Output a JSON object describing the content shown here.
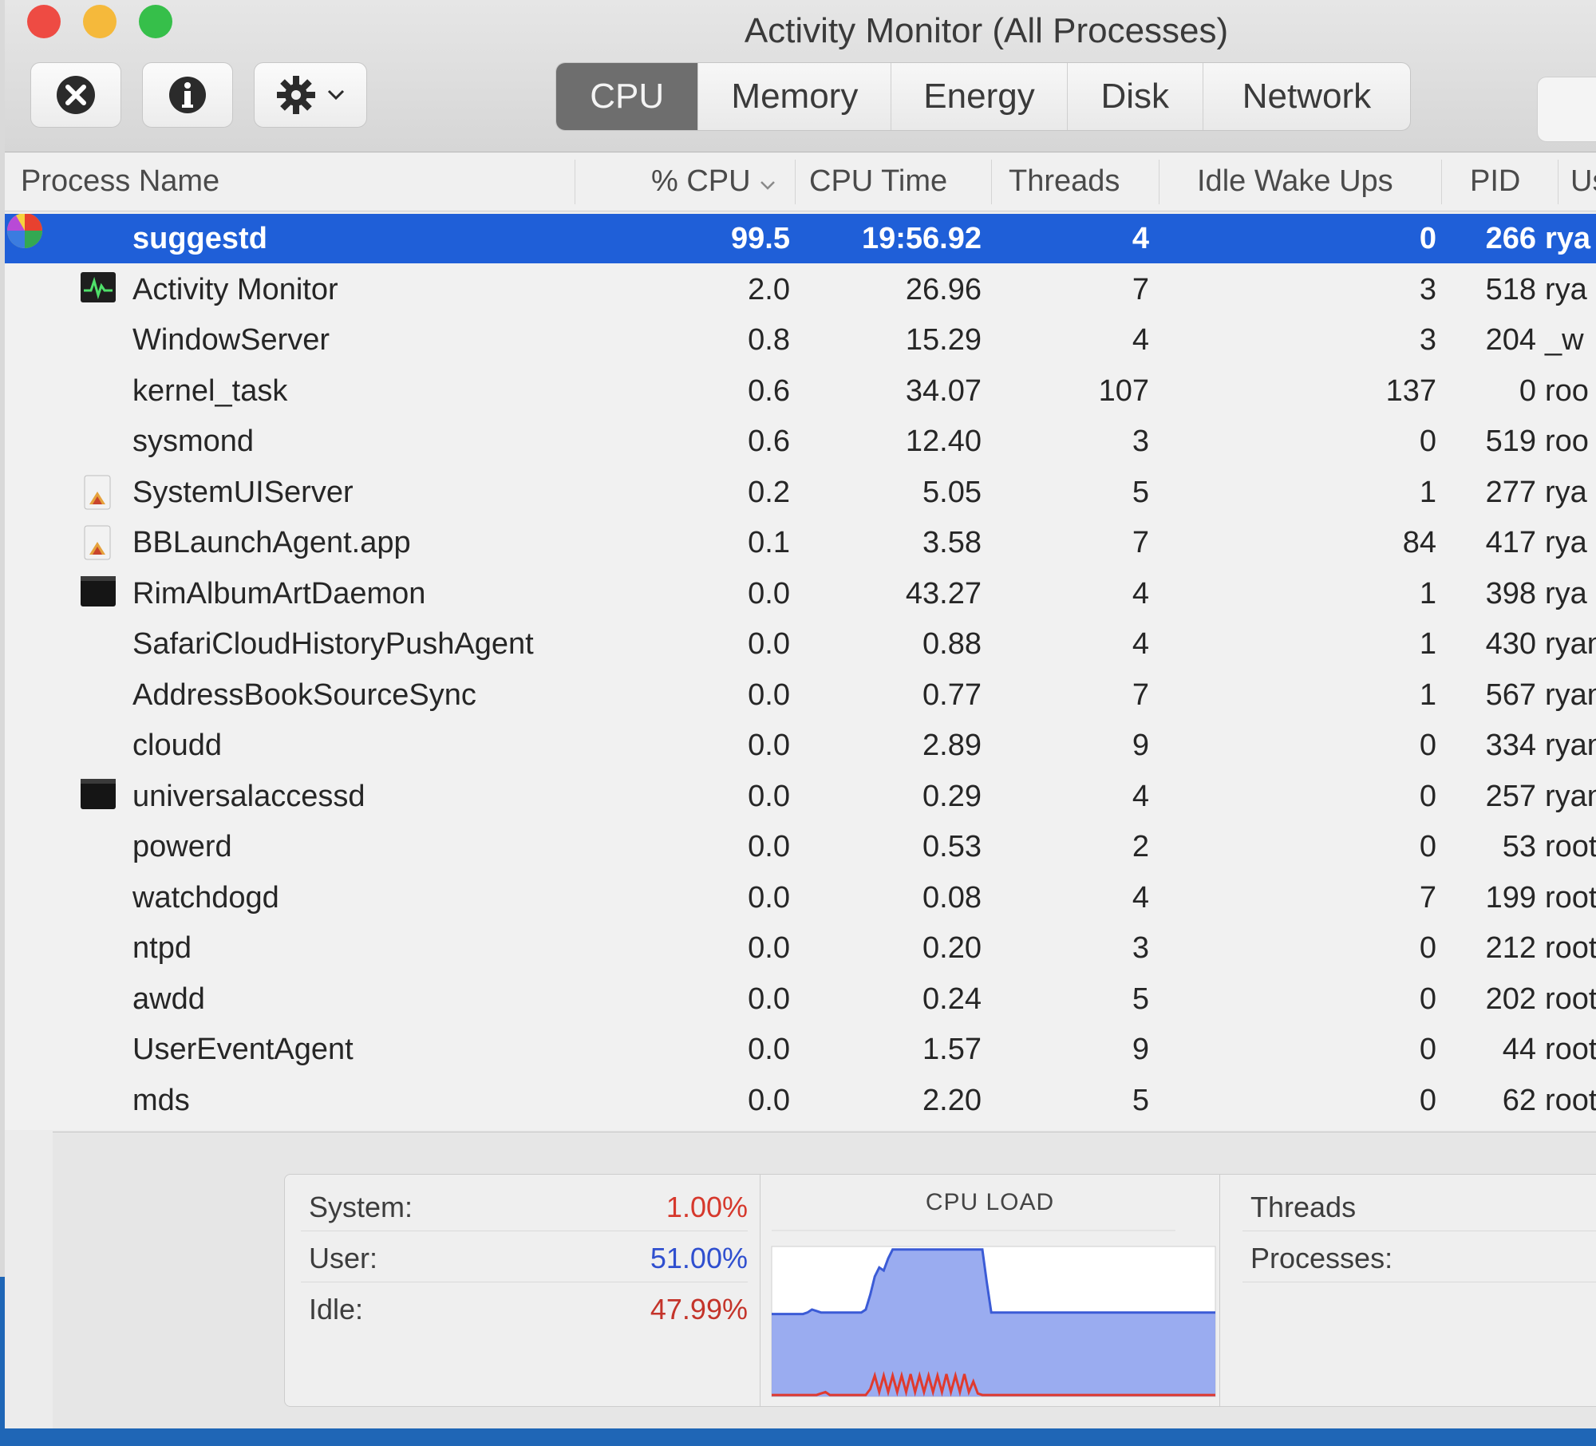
{
  "window": {
    "title": "Activity Monitor (All Processes)"
  },
  "tabs": [
    {
      "label": "CPU",
      "active": true
    },
    {
      "label": "Memory",
      "active": false
    },
    {
      "label": "Energy",
      "active": false
    },
    {
      "label": "Disk",
      "active": false
    },
    {
      "label": "Network",
      "active": false
    }
  ],
  "columns": {
    "name": "Process Name",
    "cpu": "% CPU",
    "time": "CPU Time",
    "threads": "Threads",
    "idle": "Idle Wake Ups",
    "pid": "PID",
    "user": "Us"
  },
  "processes": [
    {
      "name": "suggestd",
      "cpu": "99.5",
      "time": "19:56.92",
      "threads": "4",
      "idle": "0",
      "pid": "266",
      "user": "rya",
      "icon": "colorful-pinwheel-icon"
    },
    {
      "name": "Activity Monitor",
      "cpu": "2.0",
      "time": "26.96",
      "threads": "7",
      "idle": "3",
      "pid": "518",
      "user": "rya",
      "icon": "activity-monitor-icon"
    },
    {
      "name": "WindowServer",
      "cpu": "0.8",
      "time": "15.29",
      "threads": "4",
      "idle": "3",
      "pid": "204",
      "user": "_w",
      "icon": ""
    },
    {
      "name": "kernel_task",
      "cpu": "0.6",
      "time": "34.07",
      "threads": "107",
      "idle": "137",
      "pid": "0",
      "user": "roo",
      "icon": ""
    },
    {
      "name": "sysmond",
      "cpu": "0.6",
      "time": "12.40",
      "threads": "3",
      "idle": "0",
      "pid": "519",
      "user": "roo",
      "icon": ""
    },
    {
      "name": "SystemUIServer",
      "cpu": "0.2",
      "time": "5.05",
      "threads": "5",
      "idle": "1",
      "pid": "277",
      "user": "rya",
      "icon": "app-document-icon"
    },
    {
      "name": "BBLaunchAgent.app",
      "cpu": "0.1",
      "time": "3.58",
      "threads": "7",
      "idle": "84",
      "pid": "417",
      "user": "rya",
      "icon": "app-document-icon"
    },
    {
      "name": "RimAlbumArtDaemon",
      "cpu": "0.0",
      "time": "43.27",
      "threads": "4",
      "idle": "1",
      "pid": "398",
      "user": "rya",
      "icon": "terminal-icon"
    },
    {
      "name": "SafariCloudHistoryPushAgent",
      "cpu": "0.0",
      "time": "0.88",
      "threads": "4",
      "idle": "1",
      "pid": "430",
      "user": "ryan",
      "icon": ""
    },
    {
      "name": "AddressBookSourceSync",
      "cpu": "0.0",
      "time": "0.77",
      "threads": "7",
      "idle": "1",
      "pid": "567",
      "user": "ryan",
      "icon": ""
    },
    {
      "name": "cloudd",
      "cpu": "0.0",
      "time": "2.89",
      "threads": "9",
      "idle": "0",
      "pid": "334",
      "user": "ryan",
      "icon": ""
    },
    {
      "name": "universalaccessd",
      "cpu": "0.0",
      "time": "0.29",
      "threads": "4",
      "idle": "0",
      "pid": "257",
      "user": "ryan",
      "icon": "terminal-icon"
    },
    {
      "name": "powerd",
      "cpu": "0.0",
      "time": "0.53",
      "threads": "2",
      "idle": "0",
      "pid": "53",
      "user": "root",
      "icon": ""
    },
    {
      "name": "watchdogd",
      "cpu": "0.0",
      "time": "0.08",
      "threads": "4",
      "idle": "7",
      "pid": "199",
      "user": "root",
      "icon": ""
    },
    {
      "name": "ntpd",
      "cpu": "0.0",
      "time": "0.20",
      "threads": "3",
      "idle": "0",
      "pid": "212",
      "user": "root",
      "icon": ""
    },
    {
      "name": "awdd",
      "cpu": "0.0",
      "time": "0.24",
      "threads": "5",
      "idle": "0",
      "pid": "202",
      "user": "root",
      "icon": ""
    },
    {
      "name": "UserEventAgent",
      "cpu": "0.0",
      "time": "1.57",
      "threads": "9",
      "idle": "0",
      "pid": "44",
      "user": "root",
      "icon": ""
    },
    {
      "name": "mds",
      "cpu": "0.0",
      "time": "2.20",
      "threads": "5",
      "idle": "0",
      "pid": "62",
      "user": "root",
      "icon": ""
    }
  ],
  "stats": {
    "system_label": "System:",
    "system_value": "1.00%",
    "user_label": "User:",
    "user_value": "51.00%",
    "idle_label": "Idle:",
    "idle_value": "47.99%",
    "threads_label": "Threads",
    "processes_label": "Processes:"
  },
  "chart": {
    "title": "CPU LOAD",
    "user_color": "#3b5bd6",
    "system_color": "#e03a2e",
    "user_load": [
      0.55,
      0.55,
      0.55,
      0.55,
      0.55,
      0.55,
      0.55,
      0.55,
      0.56,
      0.58,
      0.57,
      0.56,
      0.56,
      0.56,
      0.56,
      0.56,
      0.56,
      0.56,
      0.56,
      0.56,
      0.56,
      0.58,
      0.68,
      0.8,
      0.86,
      0.84,
      0.92,
      0.98,
      0.98,
      0.98,
      0.98,
      0.98,
      0.98,
      0.98,
      0.98,
      0.98,
      0.98,
      0.98,
      0.98,
      0.98,
      0.98,
      0.98,
      0.98,
      0.98,
      0.98,
      0.98,
      0.98,
      0.98,
      0.76,
      0.56,
      0.56,
      0.56,
      0.56,
      0.56,
      0.56,
      0.56,
      0.56,
      0.56,
      0.56,
      0.56,
      0.56,
      0.56,
      0.56,
      0.56,
      0.56,
      0.56,
      0.56,
      0.56,
      0.56,
      0.56,
      0.56,
      0.56,
      0.56,
      0.56,
      0.56,
      0.56,
      0.56,
      0.56,
      0.56,
      0.56,
      0.56,
      0.56,
      0.56,
      0.56,
      0.56,
      0.56,
      0.56,
      0.56,
      0.56,
      0.56,
      0.56,
      0.56,
      0.56,
      0.56,
      0.56,
      0.56,
      0.56,
      0.56,
      0.56,
      0.56
    ],
    "system_load": [
      0.01,
      0.01,
      0.01,
      0.01,
      0.01,
      0.01,
      0.01,
      0.01,
      0.01,
      0.01,
      0.01,
      0.02,
      0.03,
      0.01,
      0.01,
      0.01,
      0.01,
      0.01,
      0.01,
      0.01,
      0.01,
      0.01,
      0.05,
      0.14,
      0.03,
      0.14,
      0.03,
      0.14,
      0.03,
      0.14,
      0.03,
      0.15,
      0.03,
      0.14,
      0.03,
      0.14,
      0.03,
      0.14,
      0.03,
      0.15,
      0.03,
      0.14,
      0.03,
      0.15,
      0.03,
      0.1,
      0.02,
      0.01,
      0.01,
      0.01,
      0.01,
      0.01,
      0.01,
      0.01,
      0.01,
      0.01,
      0.01,
      0.01,
      0.01,
      0.01,
      0.01,
      0.01,
      0.01,
      0.01,
      0.01,
      0.01,
      0.01,
      0.01,
      0.01,
      0.01,
      0.01,
      0.01,
      0.01,
      0.01,
      0.01,
      0.01,
      0.01,
      0.01,
      0.01,
      0.01,
      0.01,
      0.01,
      0.01,
      0.01,
      0.01,
      0.01,
      0.01,
      0.01,
      0.01,
      0.01,
      0.01,
      0.01,
      0.01,
      0.01,
      0.01,
      0.01,
      0.01,
      0.01,
      0.01,
      0.01
    ]
  }
}
